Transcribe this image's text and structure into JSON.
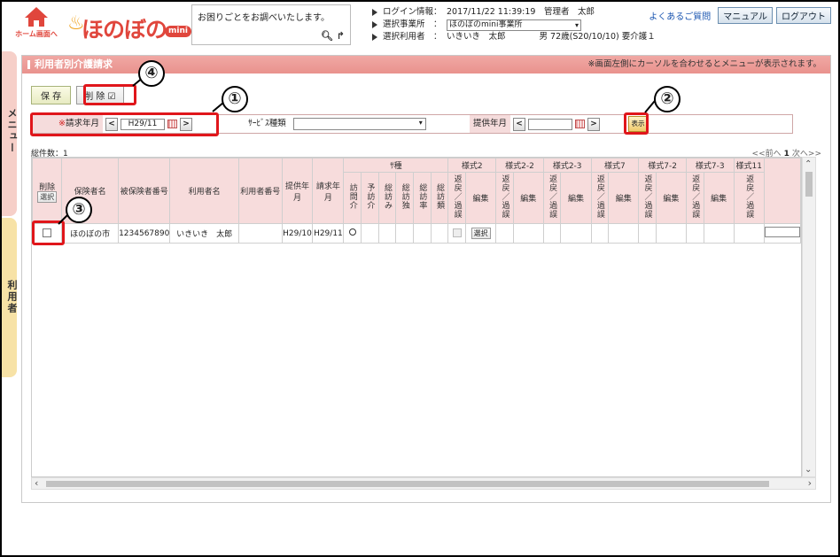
{
  "header": {
    "home_label": "ホーム画面へ",
    "logo_text": "ほのぼの",
    "logo_mini": "mini",
    "help_text": "お困りごとをお調べいたします。",
    "login_label": "ログイン情報：",
    "login_value": "2017/11/22 11:39:19　管理者　太郎",
    "office_label": "選択事業所　：",
    "office_value": "ほのぼのmini事業所",
    "user_label": "選択利用者　：",
    "user_value": "いきいき　太郎　　　　男 72歳(S20/10/10) 要介護１",
    "faq": "よくあるご質問",
    "manual": "マニュアル",
    "logout": "ログアウト"
  },
  "side": {
    "menu": "メニュー",
    "user": "利用者"
  },
  "panel": {
    "title": "利用者別介護請求",
    "note": "※画面左側にカーソルを合わせるとメニューが表示されます。",
    "save": "保 存",
    "delete": "削 除 ☑",
    "filter": {
      "req_mark": "※",
      "billing_label": "請求年月",
      "billing_value": "H29/11",
      "service_label": "ｻｰﾋﾞｽ種類",
      "service_value": "",
      "provide_label": "提供年月",
      "provide_value": ""
    },
    "show": "表示",
    "count": "総件数：1",
    "pager_prev": "<<前へ",
    "pager_page": "1",
    "pager_next": "次へ>>"
  },
  "table": {
    "h_delete": "削除",
    "h_select": "選択",
    "h_insurer": "保険者名",
    "h_insured_no": "被保険者番号",
    "h_user": "利用者名",
    "h_user_no": "利用者番号",
    "h_provide": "提供年月",
    "h_billing": "請求年月",
    "h_type": "ｻ種",
    "types": [
      "訪問介",
      "予訪介",
      "総訪み",
      "総訪独",
      "総訪率",
      "総訪類"
    ],
    "styles": [
      "様式2",
      "様式2-2",
      "様式2-3",
      "様式7",
      "様式7-2",
      "様式7-3",
      "様式11"
    ],
    "sub_return": "返戻／過誤",
    "sub_edit": "編集",
    "row": {
      "insurer": "ほのぼの市",
      "insured_no": "1234567890",
      "user": "いきいき　太郎",
      "user_no": "",
      "provide": "H29/10",
      "billing": "H29/11",
      "edit_btn": "選択"
    }
  },
  "callouts": [
    "①",
    "②",
    "③",
    "④"
  ]
}
